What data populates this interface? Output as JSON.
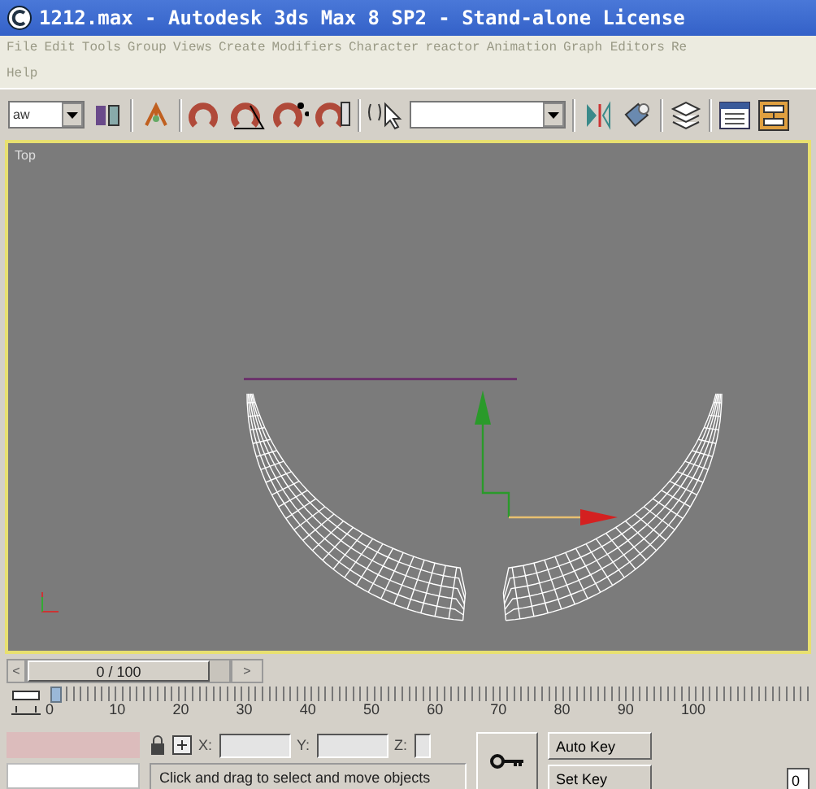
{
  "window": {
    "title": "1212.max  - Autodesk 3ds Max 8 SP2  - Stand-alone License"
  },
  "menu": [
    "File",
    "Edit",
    "Tools",
    "Group",
    "Views",
    "Create",
    "Modifiers",
    "Character",
    "reactor",
    "Animation",
    "Graph Editors",
    "Re",
    "Help"
  ],
  "toolbar": {
    "selection_filter": "aw"
  },
  "viewport": {
    "label": "Top"
  },
  "time_slider": {
    "position": "0 / 100",
    "prev": "<",
    "next": ">"
  },
  "track_bar": {
    "ticks": [
      "0",
      "10",
      "20",
      "30",
      "40",
      "50",
      "60",
      "70",
      "80",
      "90",
      "100"
    ]
  },
  "coordinates": [
    {
      "axis": "X:"
    },
    {
      "axis": "Y:"
    },
    {
      "axis": "Z:"
    }
  ],
  "status": "Click and drag to select and move objects",
  "animation": {
    "auto_key": "Auto Key",
    "set_key": "Set Key",
    "frame": "0"
  }
}
